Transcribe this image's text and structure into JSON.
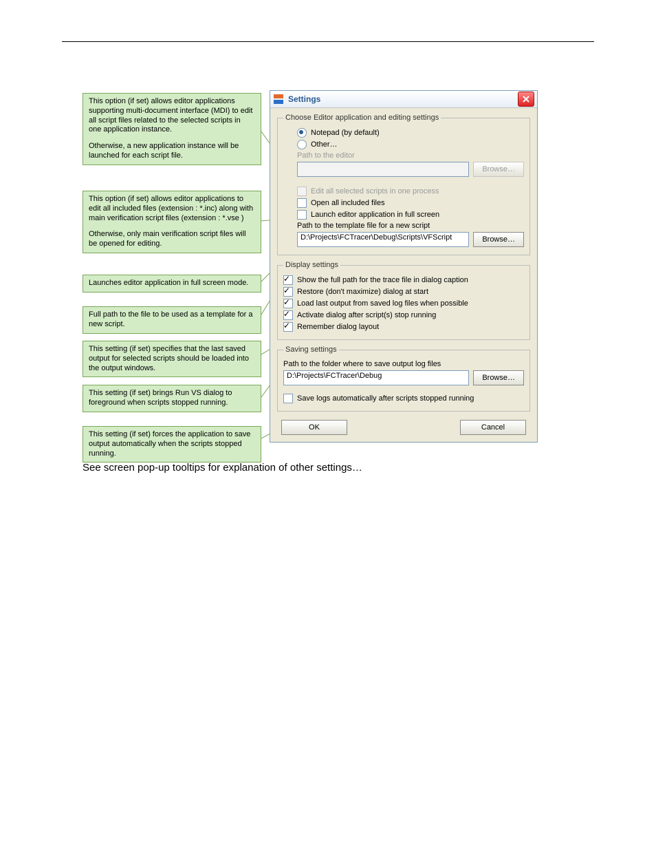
{
  "callouts": {
    "c1a": "This option (if set) allows editor applications supporting multi-document interface (MDI) to edit all script files related to the selected scripts in one application instance.",
    "c1b": "Otherwise, a new application instance will be launched for each script file.",
    "c2a": "This option (if set) allows editor applications to edit all included files (extension : *.inc) along with main verification script files (extension :  *.vse )",
    "c2b": "Otherwise, only main verification script files will be opened for editing.",
    "c3": "Launches editor application in full screen mode.",
    "c4": "Full path to the file to be used as a template for a new script.",
    "c5": "This setting (if set) specifies that the last saved output for selected scripts should be loaded into the output windows.",
    "c6": "This setting (if set) brings Run VS dialog to foreground when scripts stopped running.",
    "c7": "This setting (if set) forces the application to save output automatically when the scripts stopped running."
  },
  "dialog": {
    "title": "Settings",
    "editor": {
      "legend": "Choose Editor application and editing settings",
      "notepad": "Notepad (by default)",
      "other": "Other…",
      "pathLabel": "Path to the editor",
      "browse": "Browse…",
      "editAll": "Edit all selected scripts in one process",
      "openIncluded": "Open all included files",
      "fullScreen": "Launch editor application in full screen",
      "templateLabel": "Path to the template file for a new script",
      "templateValue": "D:\\Projects\\FCTracer\\Debug\\Scripts\\VFScript",
      "templateBrowse": "Browse…"
    },
    "display": {
      "legend": "Display settings",
      "fullPath": "Show the full path for the trace file in dialog caption",
      "restore": "Restore (don't maximize) dialog at start",
      "loadLast": "Load last output from saved log files when possible",
      "activate": "Activate dialog after script(s) stop running",
      "remember": "Remember dialog layout"
    },
    "saving": {
      "legend": "Saving settings",
      "folderLabel": "Path to the folder where to save output log files",
      "folderValue": "D:\\Projects\\FCTracer\\Debug",
      "browse": "Browse…",
      "autoSave": "Save logs automatically after scripts stopped running"
    },
    "ok": "OK",
    "cancel": "Cancel"
  },
  "footnote": "See screen pop-up tooltips for explanation of other settings…"
}
